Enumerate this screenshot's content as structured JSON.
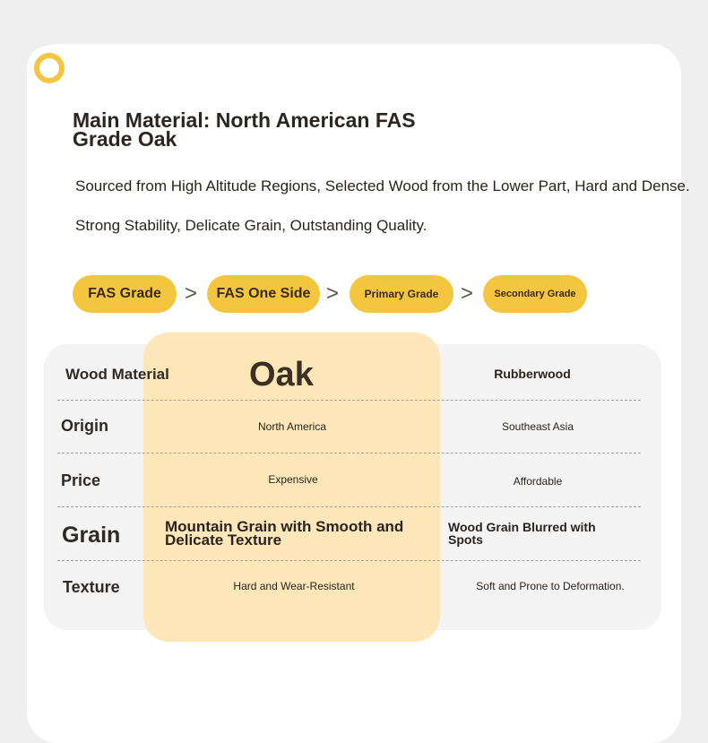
{
  "header": {
    "title": "Main Material: North American FAS Grade Oak",
    "description_line1": "Sourced from High Altitude Regions, Selected Wood from the Lower Part, Hard and Dense.",
    "description_line2": "Strong Stability, Delicate Grain, Outstanding Quality."
  },
  "grades": {
    "items": [
      "FAS Grade",
      "FAS One Side",
      "Primary Grade",
      "Secondary Grade"
    ],
    "separator": ">"
  },
  "comparison": {
    "header": {
      "label": "Wood Material",
      "oak": "Oak",
      "other": "Rubberwood"
    },
    "rows": [
      {
        "label": "Origin",
        "oak": "North America",
        "other": "Southeast Asia"
      },
      {
        "label": "Price",
        "oak": "Expensive",
        "other": "Affordable"
      },
      {
        "label": "Grain",
        "oak": "Mountain Grain with Smooth and Delicate Texture",
        "other": "Wood Grain Blurred with Spots"
      },
      {
        "label": "Texture",
        "oak": "Hard and Wear-Resistant",
        "other": "Soft and Prone to Deformation."
      }
    ]
  },
  "colors": {
    "accent": "#f4c53e",
    "highlight": "#fde7b8",
    "card": "#ffffff",
    "background": "#efefef"
  }
}
